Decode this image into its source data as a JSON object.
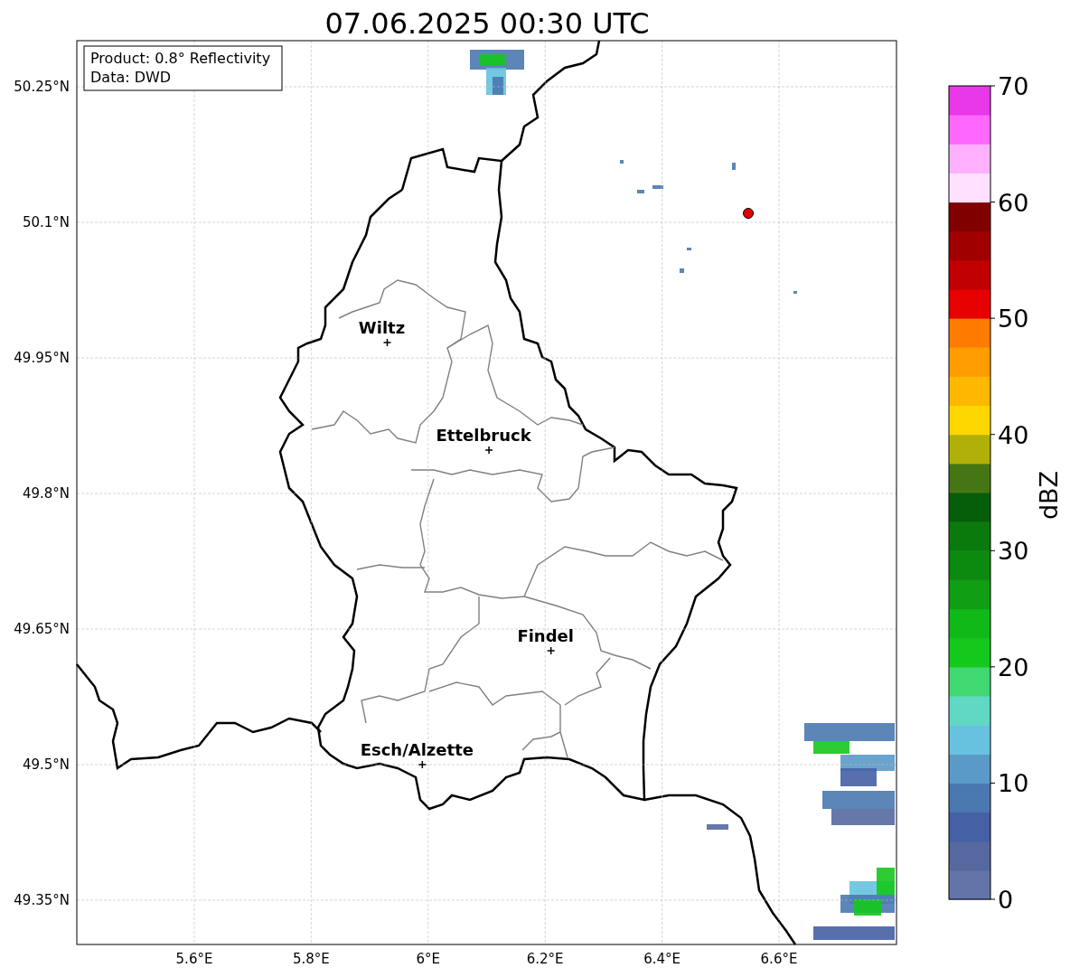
{
  "title": "07.06.2025 00:30 UTC",
  "info_box": [
    "Product: 0.8° Reflectivity",
    "Data: DWD"
  ],
  "y_ticks": [
    "50.25°N",
    "50.1°N",
    "49.95°N",
    "49.8°N",
    "49.65°N",
    "49.5°N",
    "49.35°N"
  ],
  "x_ticks": [
    "5.6°E",
    "5.8°E",
    "6°E",
    "6.2°E",
    "6.4°E",
    "6.6°E"
  ],
  "cities": [
    {
      "name": "Wiltz"
    },
    {
      "name": "Ettelbruck"
    },
    {
      "name": "Findel"
    },
    {
      "name": "Esch/Alzette"
    }
  ],
  "colorbar": {
    "label": "dBZ",
    "ticks": [
      "70",
      "60",
      "50",
      "40",
      "30",
      "20",
      "10",
      "0"
    ],
    "segments": [
      {
        "color": "#6474a8"
      },
      {
        "color": "#5568a0"
      },
      {
        "color": "#4560a4"
      },
      {
        "color": "#4a78b0"
      },
      {
        "color": "#5a9ac8"
      },
      {
        "color": "#66c2de"
      },
      {
        "color": "#60d8c4"
      },
      {
        "color": "#40d870"
      },
      {
        "color": "#14c81c"
      },
      {
        "color": "#10b818"
      },
      {
        "color": "#109e14"
      },
      {
        "color": "#0c8a10"
      },
      {
        "color": "#0a7a0c"
      },
      {
        "color": "#075e0a"
      },
      {
        "color": "#467614"
      },
      {
        "color": "#b0b008"
      },
      {
        "color": "#ffd700"
      },
      {
        "color": "#ffb800"
      },
      {
        "color": "#ff9c00"
      },
      {
        "color": "#ff7c00"
      },
      {
        "color": "#e60000"
      },
      {
        "color": "#c00000"
      },
      {
        "color": "#a00000"
      },
      {
        "color": "#800000"
      },
      {
        "color": "#ffe0ff"
      },
      {
        "color": "#ffb0ff"
      },
      {
        "color": "#ff68ff"
      },
      {
        "color": "#e838e8"
      }
    ]
  }
}
